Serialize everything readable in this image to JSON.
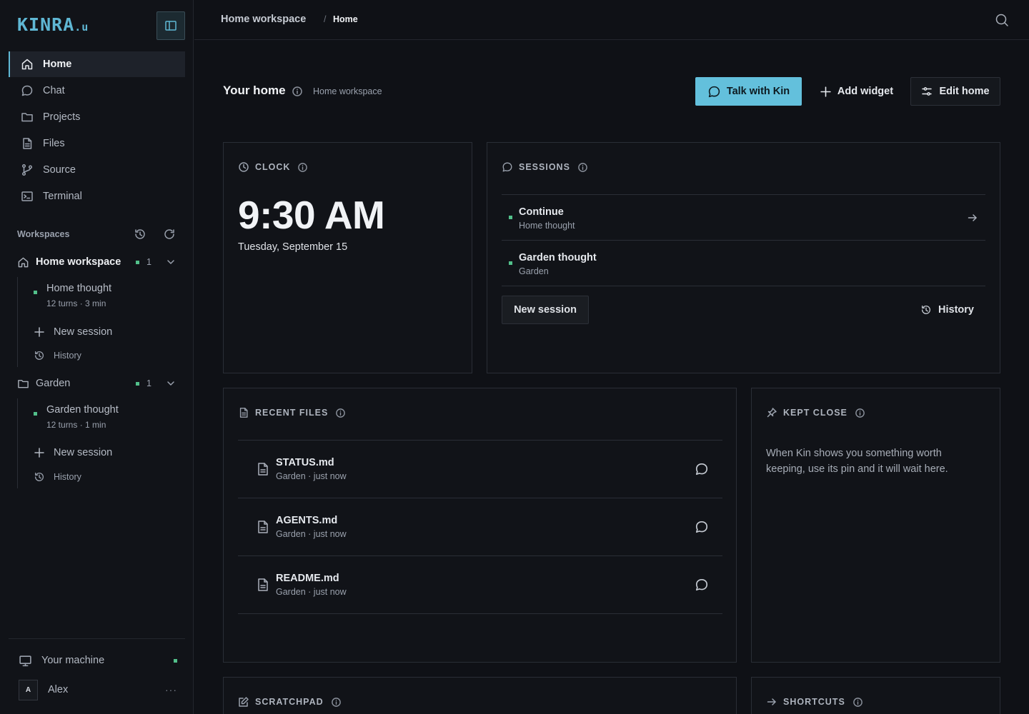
{
  "app": {
    "logo": "KINRA",
    "logo_suffix": ".u",
    "brand_color": "#5fb7d4",
    "status_color": "#52c08a"
  },
  "sidebar": {
    "nav": [
      {
        "label": "Home",
        "icon": "home-icon",
        "active": true
      },
      {
        "label": "Chat",
        "icon": "chat-icon"
      },
      {
        "label": "Projects",
        "icon": "folder-icon"
      },
      {
        "label": "Files",
        "icon": "file-icon"
      },
      {
        "label": "Source",
        "icon": "git-branch-icon"
      },
      {
        "label": "Terminal",
        "icon": "terminal-icon"
      }
    ],
    "workspaces_title": "Workspaces",
    "workspaces": [
      {
        "name": "Home workspace",
        "count": "1",
        "sessions": [
          {
            "title": "Home thought",
            "meta": "12 turns · 3 min"
          }
        ],
        "new_session": "New session",
        "history": "History"
      },
      {
        "name": "Garden",
        "count": "1",
        "sessions": [
          {
            "title": "Garden thought",
            "meta": "12 turns · 1 min"
          }
        ],
        "new_session": "New session",
        "history": "History"
      }
    ],
    "machine": "Your machine",
    "user": {
      "initial": "A",
      "name": "Alex",
      "more": "···"
    }
  },
  "topbar": {
    "crumbs": [
      "Home workspace",
      "Home"
    ],
    "separator": "/"
  },
  "header": {
    "title": "Your home",
    "subtitle": "Home workspace",
    "talk_button": "Talk with Kin",
    "add_widget": "Add widget",
    "edit_home": "Edit home"
  },
  "clock": {
    "title": "CLOCK",
    "time": "9:30 AM",
    "date": "Tuesday, September 15"
  },
  "sessions": {
    "title": "SESSIONS",
    "items": [
      {
        "title": "Continue",
        "subtitle": "Home thought"
      },
      {
        "title": "Garden thought",
        "subtitle": "Garden"
      }
    ],
    "new_session": "New session",
    "history": "History"
  },
  "recent_files": {
    "title": "RECENT FILES",
    "items": [
      {
        "name": "STATUS.md",
        "meta": "Garden · just now"
      },
      {
        "name": "AGENTS.md",
        "meta": "Garden · just now"
      },
      {
        "name": "README.md",
        "meta": "Garden · just now"
      }
    ]
  },
  "kept_close": {
    "title": "KEPT CLOSE",
    "text": "When Kin shows you something worth keeping, use its pin and it will wait here."
  },
  "scratchpad": {
    "title": "SCRATCHPAD"
  },
  "shortcuts": {
    "title": "SHORTCUTS"
  }
}
